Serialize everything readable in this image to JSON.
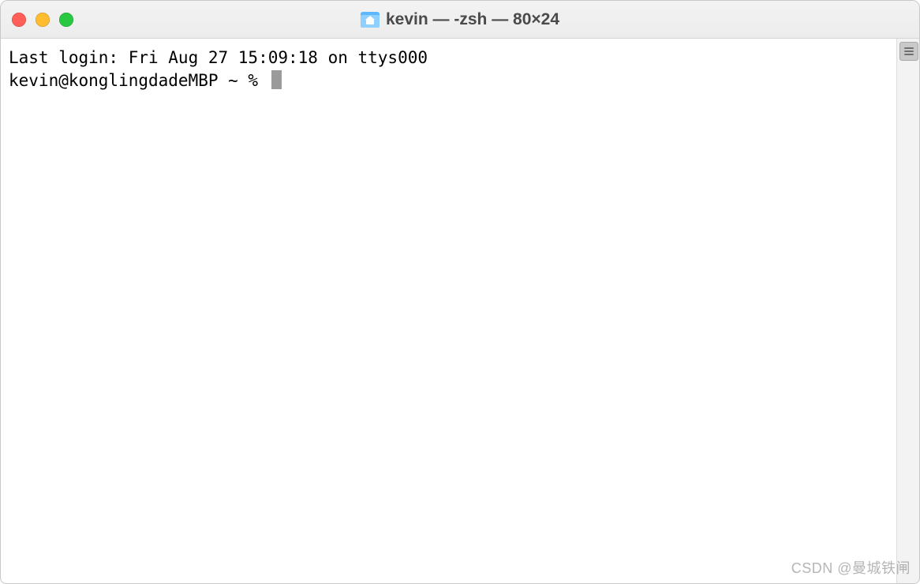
{
  "window": {
    "title": "kevin — -zsh — 80×24"
  },
  "terminal": {
    "last_login_line": "Last login: Fri Aug 27 15:09:18 on ttys000",
    "prompt": "kevin@konglingdadeMBP ~ % "
  },
  "watermark": "CSDN @曼城铁闸"
}
